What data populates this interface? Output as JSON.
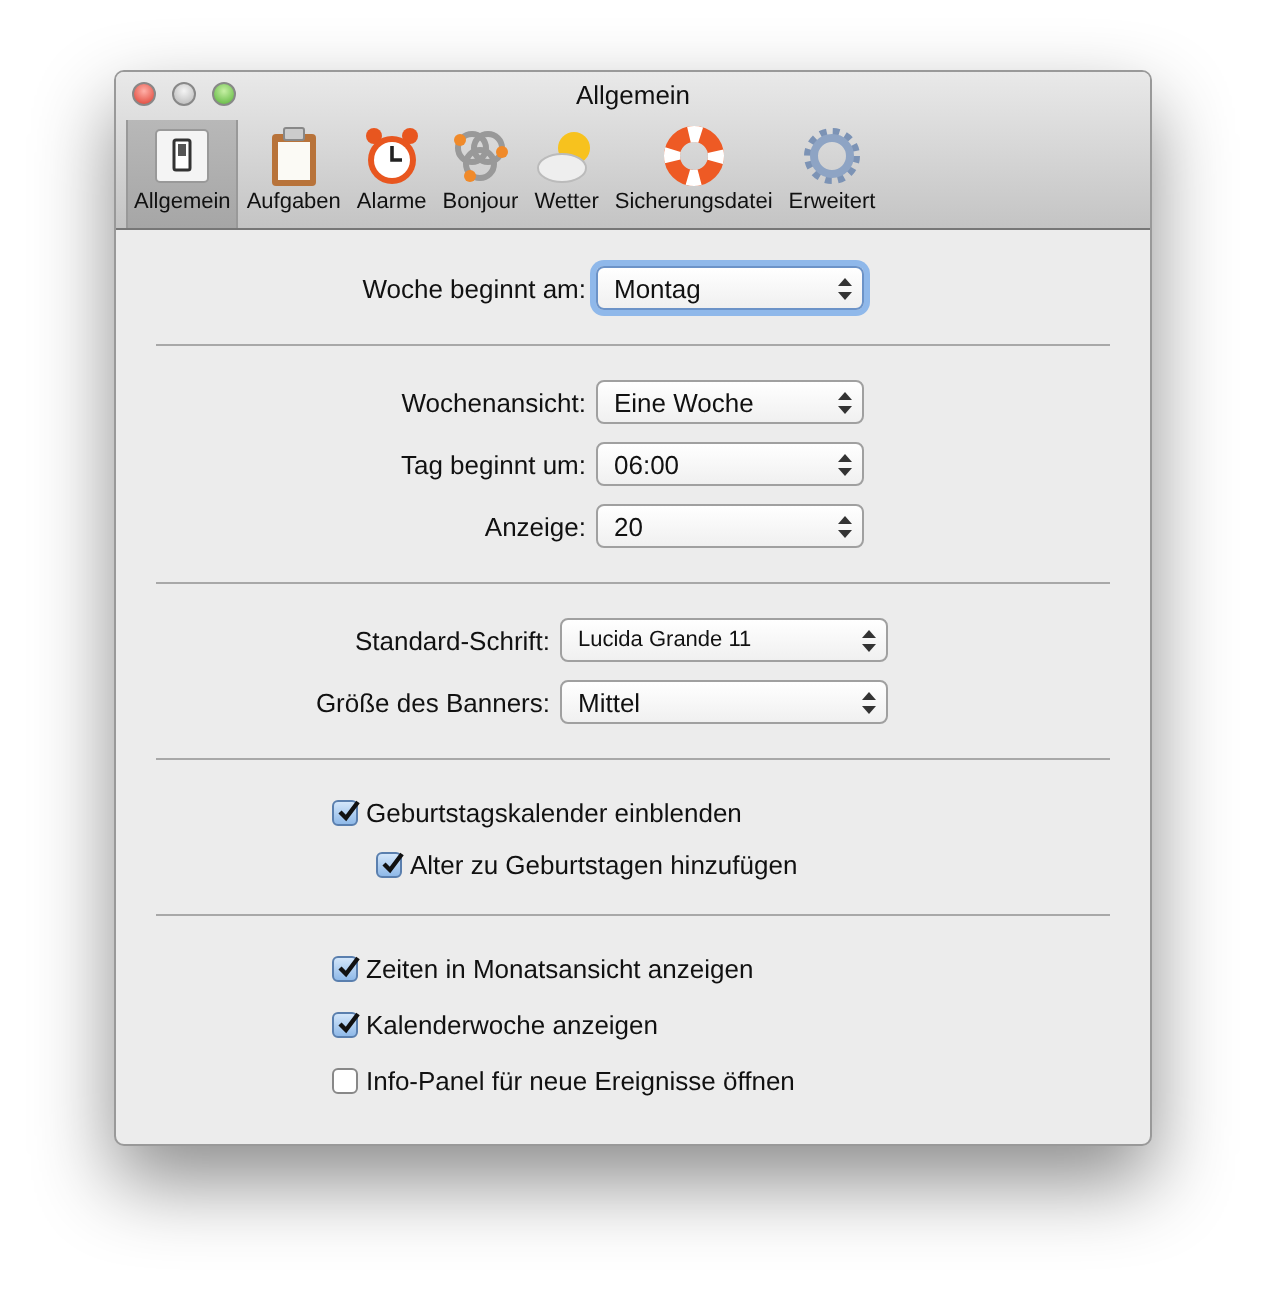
{
  "window": {
    "title": "Allgemein"
  },
  "toolbar": {
    "items": [
      {
        "label": "Allgemein",
        "kind": "switch",
        "selected": true
      },
      {
        "label": "Aufgaben",
        "kind": "clipboard",
        "selected": false
      },
      {
        "label": "Alarme",
        "kind": "clock",
        "selected": false
      },
      {
        "label": "Bonjour",
        "kind": "bonjour",
        "selected": false
      },
      {
        "label": "Wetter",
        "kind": "weather",
        "selected": false
      },
      {
        "label": "Sicherungsdatei",
        "kind": "lifebuoy",
        "selected": false
      },
      {
        "label": "Erweitert",
        "kind": "gear",
        "selected": false
      }
    ]
  },
  "sections": [
    {
      "kind": "popups",
      "rows": [
        {
          "label": "Woche beginnt am:",
          "value": "Montag",
          "focused": true
        }
      ]
    },
    {
      "kind": "popups",
      "rows": [
        {
          "label": "Wochenansicht:",
          "value": "Eine Woche",
          "focused": false
        },
        {
          "label": "Tag beginnt um:",
          "value": "06:00",
          "focused": false
        },
        {
          "label": "Anzeige:",
          "value": "20",
          "focused": false
        }
      ]
    },
    {
      "kind": "popups",
      "rows": [
        {
          "label": "Standard-Schrift:",
          "value": "Lucida Grande 11",
          "focused": false,
          "small": true
        },
        {
          "label": "Größe des Banners:",
          "value": "Mittel",
          "focused": false
        }
      ]
    },
    {
      "kind": "checkboxes",
      "items": [
        {
          "label": "Geburtstagskalender einblenden",
          "checked": true,
          "children": [
            {
              "label": "Alter zu Geburtstagen hinzufügen",
              "checked": true
            }
          ]
        }
      ]
    },
    {
      "kind": "checkboxes",
      "items": [
        {
          "label": "Zeiten in Monatsansicht anzeigen",
          "checked": true
        },
        {
          "label": "Kalenderwoche anzeigen",
          "checked": true
        },
        {
          "label": "Info-Panel für neue Ereignisse öffnen",
          "checked": false
        }
      ]
    }
  ]
}
